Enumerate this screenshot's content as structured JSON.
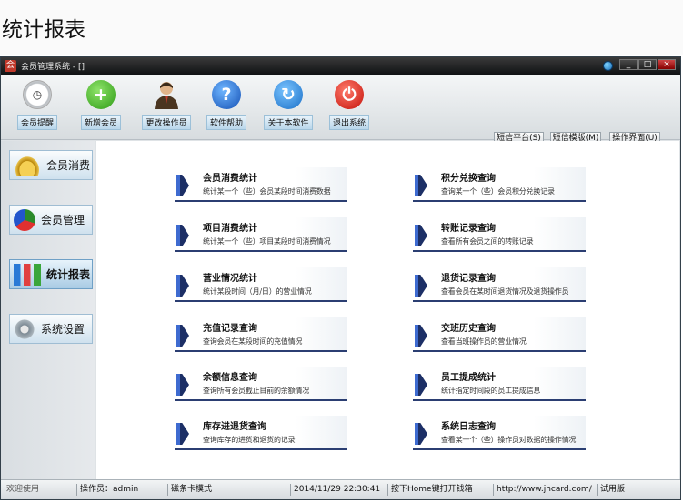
{
  "page_heading": "统计报表",
  "window": {
    "title": "会员管理系统 - []",
    "controls": {
      "minimize": "_",
      "maximize": "□",
      "close": "×"
    }
  },
  "toolbar": {
    "buttons": [
      {
        "label": "会员提醒",
        "icon": "clock-icon"
      },
      {
        "label": "新增会员",
        "icon": "plus-icon"
      },
      {
        "label": "更改操作员",
        "icon": "user-icon"
      },
      {
        "label": "软件帮助",
        "icon": "help-icon"
      },
      {
        "label": "关于本软件",
        "icon": "about-icon"
      },
      {
        "label": "退出系统",
        "icon": "exit-icon"
      }
    ],
    "right_buttons": [
      {
        "label": "短信平台(S)"
      },
      {
        "label": "短信模版(M)"
      },
      {
        "label": "操作界面(U)"
      }
    ]
  },
  "sidebar": {
    "items": [
      {
        "label": "会员消费",
        "icon": "coins-icon"
      },
      {
        "label": "会员管理",
        "icon": "pie-chart-icon"
      },
      {
        "label": "统计报表",
        "icon": "bar-chart-icon",
        "active": true
      },
      {
        "label": "系统设置",
        "icon": "gear-icon"
      }
    ]
  },
  "reports": {
    "left": [
      {
        "title": "会员消费统计",
        "desc": "统计某一个（些）会员某段时间消费数据"
      },
      {
        "title": "项目消费统计",
        "desc": "统计某一个（些）项目某段时间消费情况"
      },
      {
        "title": "营业情况统计",
        "desc": "统计某段时间（月/日）的营业情况"
      },
      {
        "title": "充值记录查询",
        "desc": "查询会员在某段时间的充值情况"
      },
      {
        "title": "余额信息查询",
        "desc": "查询所有会员截止目前的余额情况"
      },
      {
        "title": "库存进退货查询",
        "desc": "查询库存的进货和退货的记录"
      }
    ],
    "right": [
      {
        "title": "积分兑换查询",
        "desc": "查询某一个（些）会员积分兑换记录"
      },
      {
        "title": "转账记录查询",
        "desc": "查看所有会员之间的转账记录"
      },
      {
        "title": "退货记录查询",
        "desc": "查看会员在某时间退货情况及退货操作员"
      },
      {
        "title": "交班历史查询",
        "desc": "查看当班操作员的营业情况"
      },
      {
        "title": "员工提成统计",
        "desc": "统计指定时间段的员工提成信息"
      },
      {
        "title": "系统日志查询",
        "desc": "查看某一个（些）操作员对数据的操作情况"
      }
    ]
  },
  "statusbar": {
    "welcome": "欢迎使用",
    "operator": "操作员：admin",
    "card_mode": "磁条卡模式",
    "datetime": "2014/11/29 22:30:41",
    "hint": "按下Home键打开钱箱",
    "url": "http://www.jhcard.com/",
    "edition": "试用版"
  }
}
